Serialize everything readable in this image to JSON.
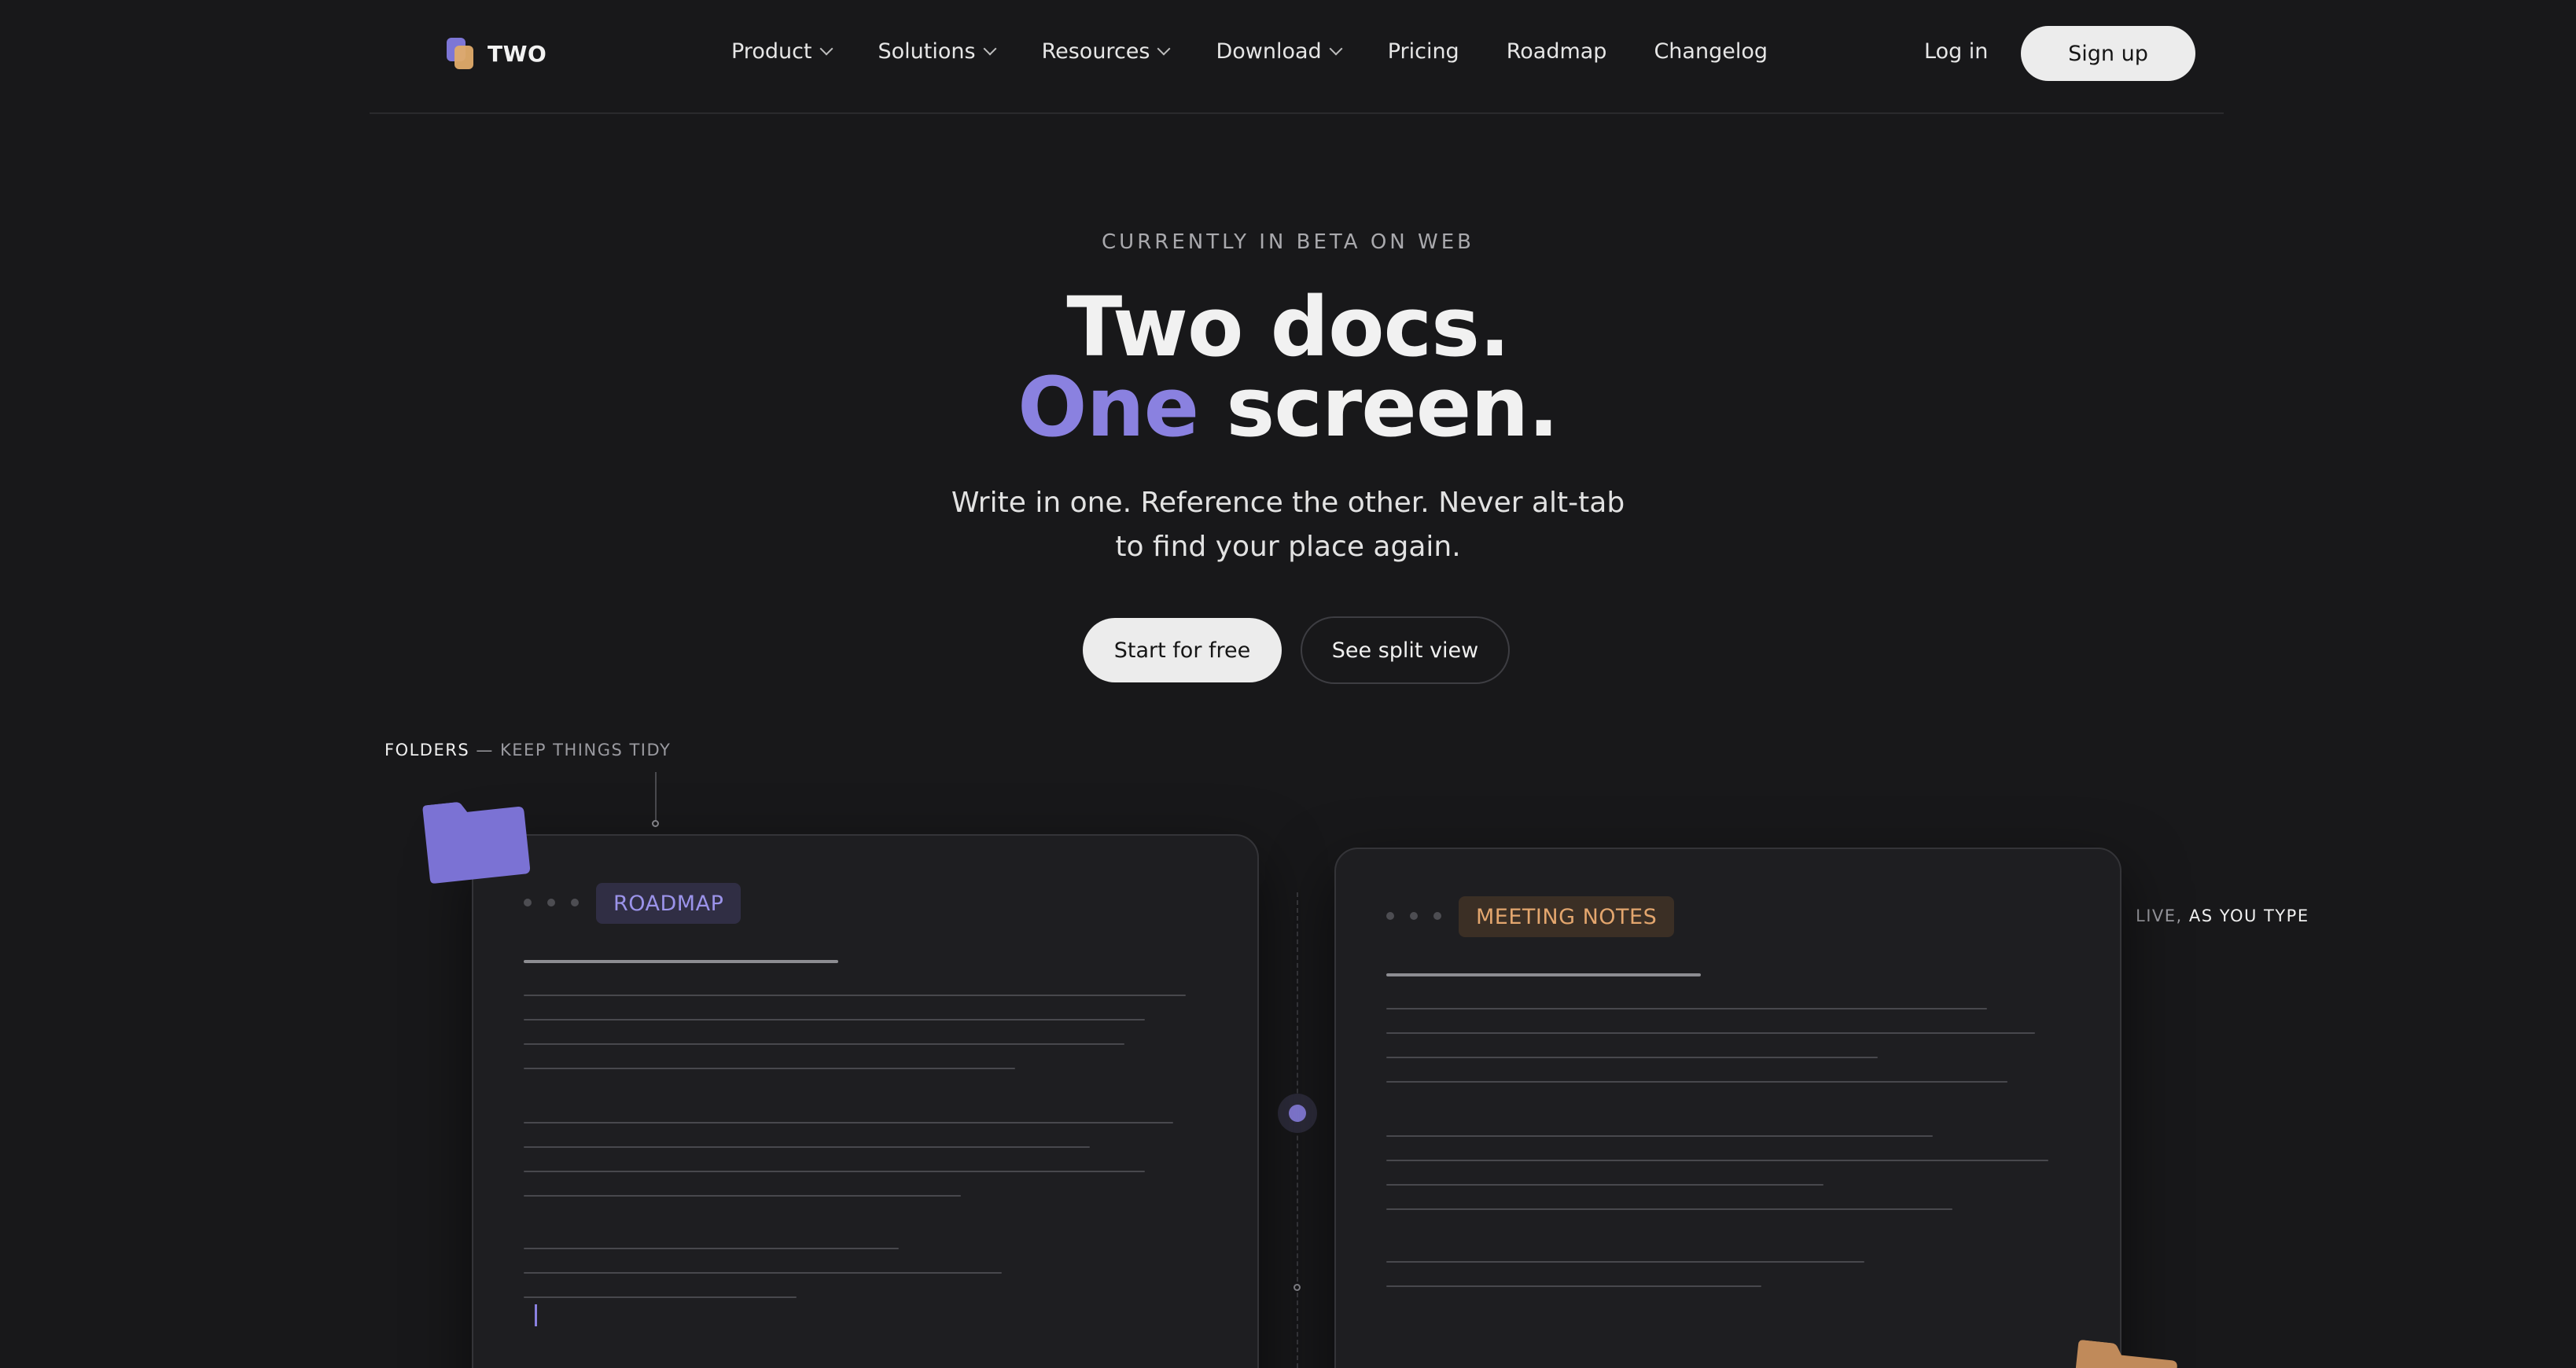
{
  "nav": {
    "brand": "TWO",
    "menu": [
      {
        "label": "Product",
        "dropdown": true
      },
      {
        "label": "Solutions",
        "dropdown": true
      },
      {
        "label": "Resources",
        "dropdown": true
      },
      {
        "label": "Download",
        "dropdown": true
      },
      {
        "label": "Pricing",
        "dropdown": false
      },
      {
        "label": "Roadmap",
        "dropdown": false
      },
      {
        "label": "Changelog",
        "dropdown": false
      }
    ],
    "login_label": "Log in",
    "signup_label": "Sign up"
  },
  "hero": {
    "eyebrow": "CURRENTLY IN BETA ON WEB",
    "title_line1": "Two docs.",
    "title_accent": "One",
    "title_line2_rest": "screen.",
    "subtitle": "Write in one. Reference the other. Never alt-tab to find your place again.",
    "primary_cta": "Start for free",
    "secondary_cta": "See split view"
  },
  "captions": {
    "left_strong": "FOLDERS",
    "left_rest": " — KEEP THINGS TIDY",
    "right_lead": "LIVE, ",
    "right_strong": "AS YOU TYPE"
  },
  "cards": {
    "left_tag": "ROADMAP",
    "right_tag": "MEETING NOTES"
  },
  "colors": {
    "background": "#18181a",
    "accent_purple": "#8a81e0",
    "accent_orange": "#e0ab6a",
    "button_light": "#ececec"
  }
}
